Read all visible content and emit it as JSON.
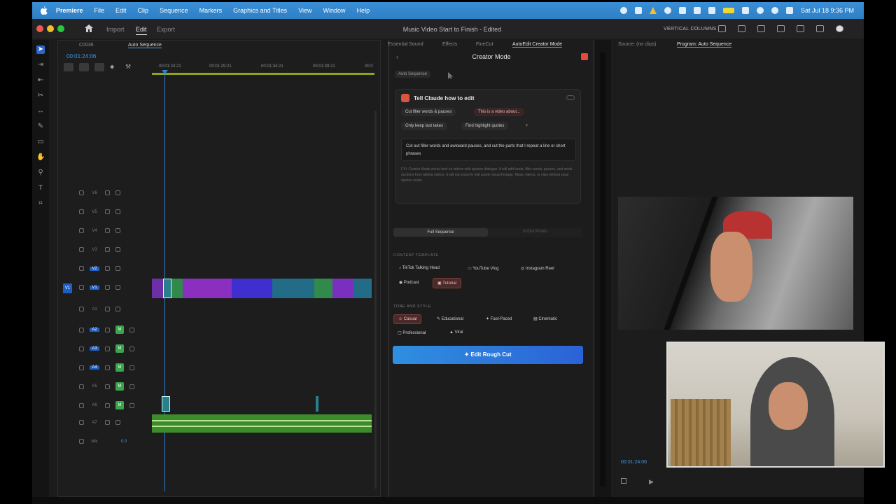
{
  "menubar": {
    "app": "Premiere",
    "items": [
      "File",
      "Edit",
      "Clip",
      "Sequence",
      "Markers",
      "Graphics and Titles",
      "View",
      "Window",
      "Help"
    ],
    "clock": "Sat Jul 18  9:36 PM"
  },
  "titlebar": {
    "tabs": [
      "Import",
      "Edit",
      "Export"
    ],
    "project": "Music Video Start to Finish - Edited",
    "workspace": "VERTICAL COLUMNS"
  },
  "timeline": {
    "tabs": [
      "C0036",
      "Auto Sequence"
    ],
    "timecode": "00:01:24:06",
    "ruler": [
      "00:01:24:21",
      "00:01:29:21",
      "00:01:34:21",
      "00:01:39:21",
      "00:0"
    ],
    "video_tracks": [
      "V6",
      "V5",
      "V4",
      "V3",
      "V2",
      "V1"
    ],
    "audio_tracks": [
      "A1",
      "A2",
      "A3",
      "A4",
      "A5",
      "A6",
      "A7"
    ],
    "mix_label": "Mix",
    "mix_value": "0.0"
  },
  "panel": {
    "tabs": [
      "Essential Sound",
      "Effects",
      "FineCut",
      "AutoEdit Creator Mode"
    ],
    "title": "Creator Mode",
    "sequence_chip": "Auto Sequence",
    "ask_title": "Tell Claude how to edit",
    "quick_chips": [
      "Cut filler words & pauses",
      "This is a video about...",
      "Only keep last takes",
      "Find highlight quotes",
      "+"
    ],
    "instruction": "Cut out filler words and awkward pauses, and cut the parts that I repeat a line or short phrases",
    "hint": "FYI: Creator Mode works best on videos with spoken dialogue. It will add beats, filler words, pauses, and weak sections from talking videos. It will not properly edit purely visual footage. Music videos, or clips without clear spoken audio.",
    "modes": [
      "Full Sequence",
      "In/Out Points"
    ],
    "template_label": "CONTENT TEMPLATE",
    "templates": [
      "TikTok Talking Head",
      "YouTube Vlog",
      "Instagram Reel",
      "Podcast",
      "Tutorial"
    ],
    "tone_label": "TONE AND STYLE",
    "tones": [
      "Casual",
      "Educational",
      "Fast-Paced",
      "Cinematic",
      "Professional",
      "Viral"
    ],
    "cta": "Edit Rough Cut"
  },
  "monitor": {
    "tabs": [
      "Source: (no clips)",
      "Program: Auto Sequence"
    ],
    "timecode": "00:01:24:06"
  },
  "colors": {
    "menubar": "#2f7fc4",
    "accent_blue": "#2f7fd6",
    "work_area": "#8da51c",
    "selection_red": "#7a3f36",
    "cta_gradient_start": "#2f8fe0",
    "cta_gradient_end": "#2b62d6"
  }
}
